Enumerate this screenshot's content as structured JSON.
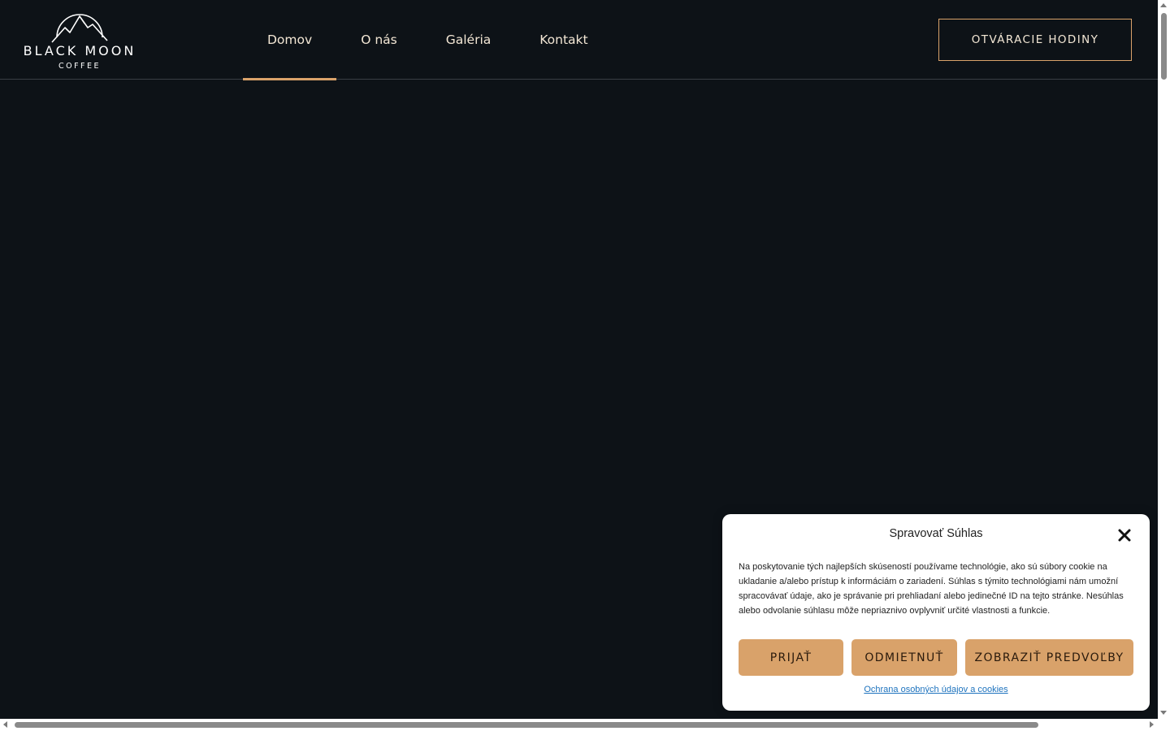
{
  "brand": {
    "name": "BLACK MOON",
    "sub": "COFFEE"
  },
  "nav": {
    "items": [
      {
        "label": "Domov",
        "active": true
      },
      {
        "label": "O nás",
        "active": false
      },
      {
        "label": "Galéria",
        "active": false
      },
      {
        "label": "Kontakt",
        "active": false
      }
    ]
  },
  "header": {
    "hours_button": "OTVÁRACIE HODINY"
  },
  "cookie": {
    "title": "Spravovať Súhlas",
    "text": "Na poskytovanie tých najlepších skúseností používame technológie, ako sú súbory cookie na ukladanie a/alebo prístup k informáciám o zariadení. Súhlas s týmito technológiami nám umožní spracovávať údaje, ako je správanie pri prehliadaní alebo jedinečné ID na tejto stránke. Nesúhlas alebo odvolanie súhlasu môže nepriaznivo ovplyvniť určité vlastnosti a funkcie.",
    "accept": "PRIJAŤ",
    "deny": "ODMIETNUŤ",
    "preferences": "ZOBRAZIŤ PREDVOĽBY",
    "link": "Ochrana osobných údajov a cookies"
  },
  "colors": {
    "background": "#0d1217",
    "accent": "#d9a26a",
    "nav_text": "#f3e7d5"
  }
}
